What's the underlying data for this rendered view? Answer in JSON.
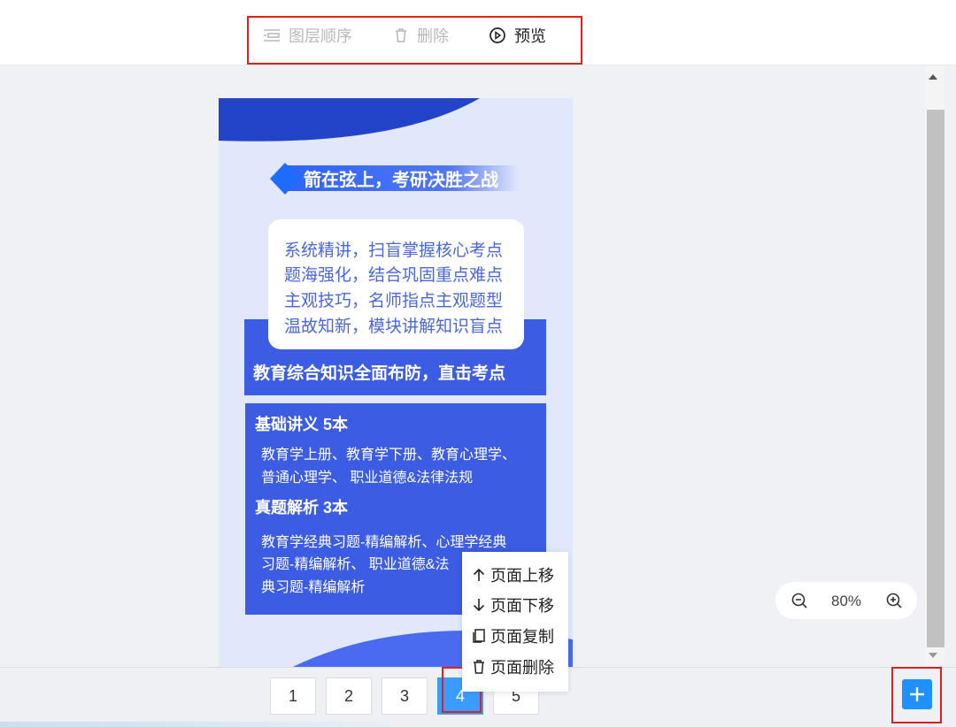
{
  "toolbar": {
    "layer_order_label": "图层顺序",
    "delete_label": "删除",
    "preview_label": "预览"
  },
  "poster": {
    "title": "箭在弦上，考研决胜之战",
    "card_lines": [
      "系统精讲，扫盲掌握核心考点",
      "题海强化，结合巩固重点难点",
      "主观技巧，名师指点主观题型",
      "温故知新，模块讲解知识盲点"
    ],
    "band_text": "教育综合知识全面布防，直击考点",
    "section1_title": "基础讲义 5本",
    "section1_lines": [
      "教育学上册、教育学下册、教育心理学、",
      "普通心理学、 职业道德&法律法规"
    ],
    "section2_title": "真题解析 3本",
    "section2_lines": [
      "教育学经典习题-精编解析、心理学经典",
      "习题-精编解析、 职业道德&法",
      "典习题-精编解析"
    ]
  },
  "context_menu": {
    "move_up": "页面上移",
    "move_down": "页面下移",
    "copy": "页面复制",
    "delete": "页面删除"
  },
  "zoom": {
    "value": "80%"
  },
  "pages": {
    "items": [
      "1",
      "2",
      "3",
      "4",
      "5"
    ],
    "active_index": 3
  },
  "colors": {
    "accent": "#3b9cff",
    "poster_blue": "#3b5ce3",
    "highlight_red": "#e21f1f",
    "add_button": "#1e90ff"
  }
}
